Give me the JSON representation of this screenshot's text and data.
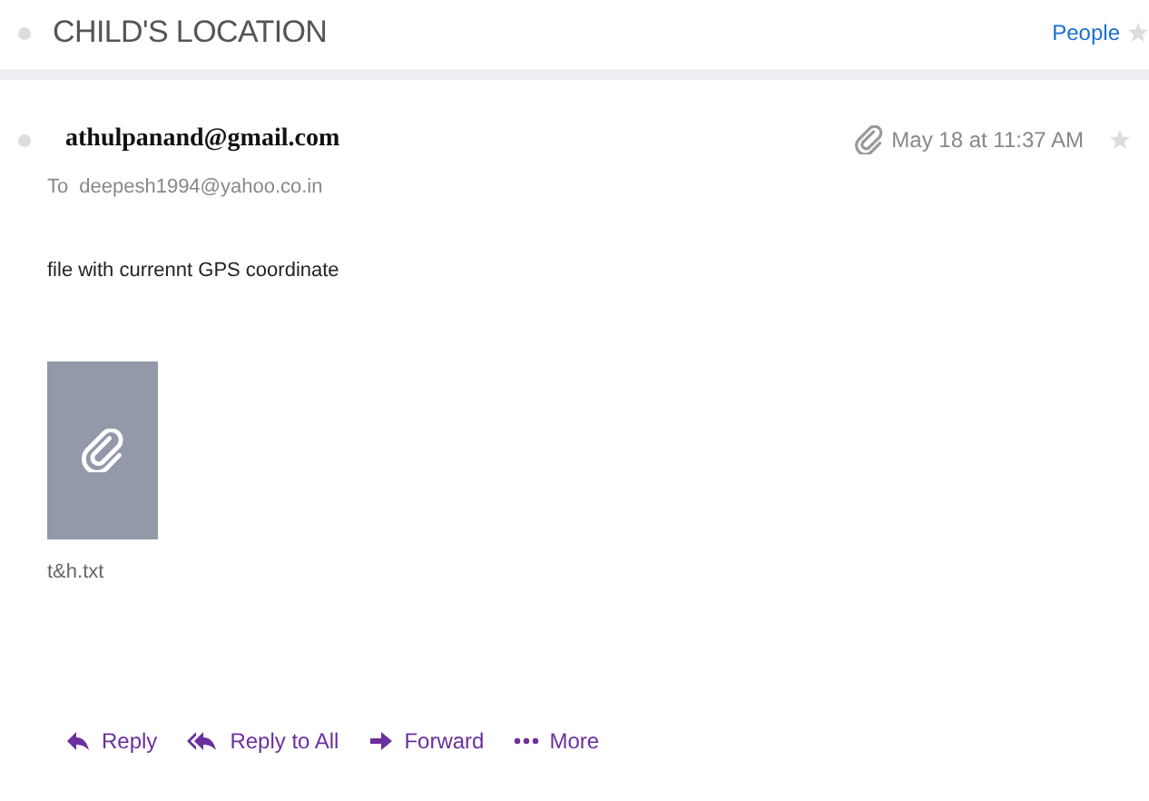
{
  "subject": "CHILD'S LOCATION",
  "people_link": "People",
  "message": {
    "sender": "athulpanand@gmail.com",
    "to_label": "To",
    "recipient": "deepesh1994@yahoo.co.in",
    "has_attachment": true,
    "date": "May 18 at 11:37 AM",
    "body": "file with currennt GPS coordinate",
    "attachments": [
      {
        "name": "t&h.txt"
      }
    ]
  },
  "actions": [
    {
      "kind": "reply",
      "label": "Reply"
    },
    {
      "kind": "reply_all",
      "label": "Reply to All"
    },
    {
      "kind": "forward",
      "label": "Forward"
    },
    {
      "kind": "more",
      "label": "More"
    }
  ]
}
